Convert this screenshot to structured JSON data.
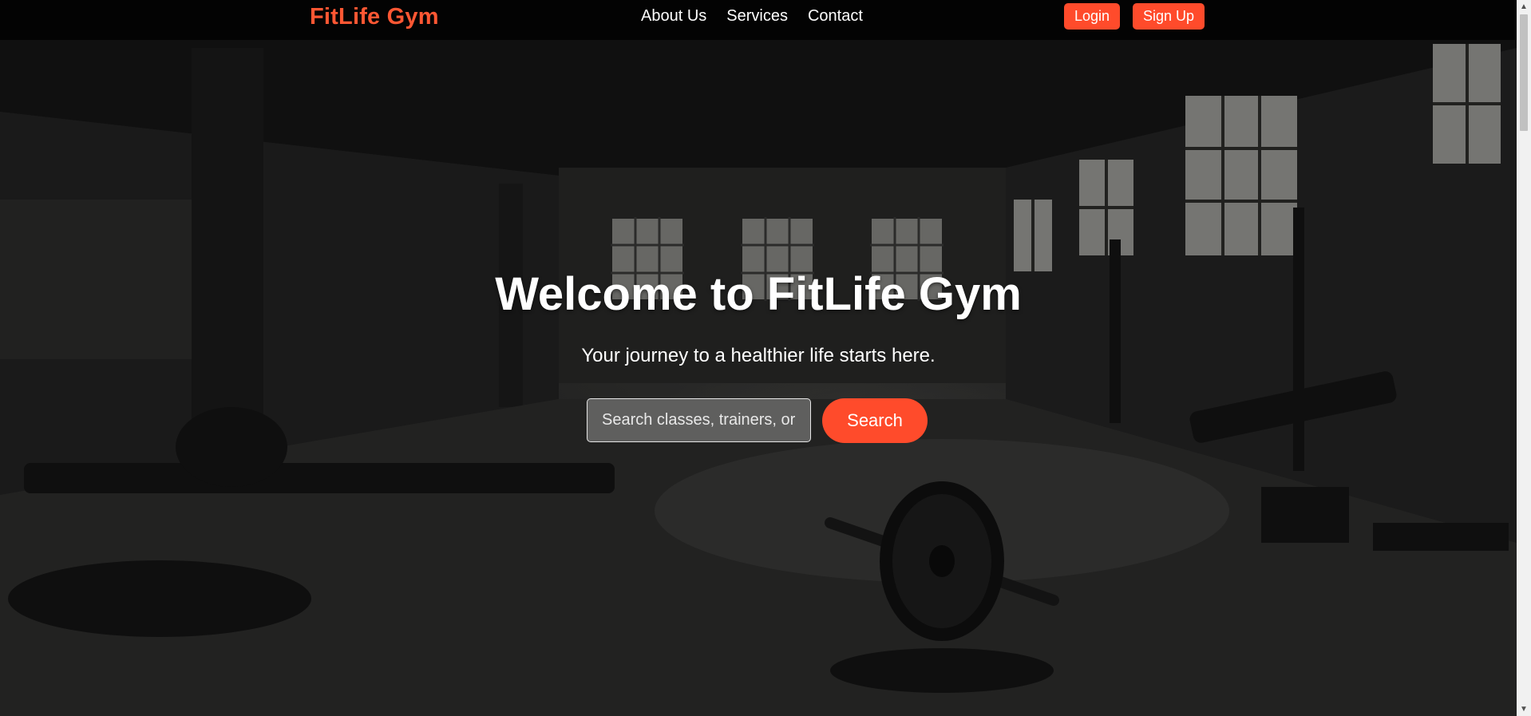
{
  "brand": {
    "name": "FitLife Gym",
    "color": "#ff5733"
  },
  "nav": {
    "links": [
      {
        "label": "About Us"
      },
      {
        "label": "Services"
      },
      {
        "label": "Contact"
      }
    ],
    "login_label": "Login",
    "signup_label": "Sign Up"
  },
  "hero": {
    "title": "Welcome to FitLife Gym",
    "subtitle": "Your journey to a healthier life starts here.",
    "background_image": "dark industrial gym interior with windows, dumbbells and weight plates"
  },
  "search": {
    "placeholder": "Search classes, trainers, or",
    "button_label": "Search"
  },
  "colors": {
    "accent": "#ff4b2b",
    "navbar": "#000000"
  },
  "icons": {
    "scroll_up": "triangle-up-icon",
    "scroll_down": "triangle-down-icon"
  }
}
